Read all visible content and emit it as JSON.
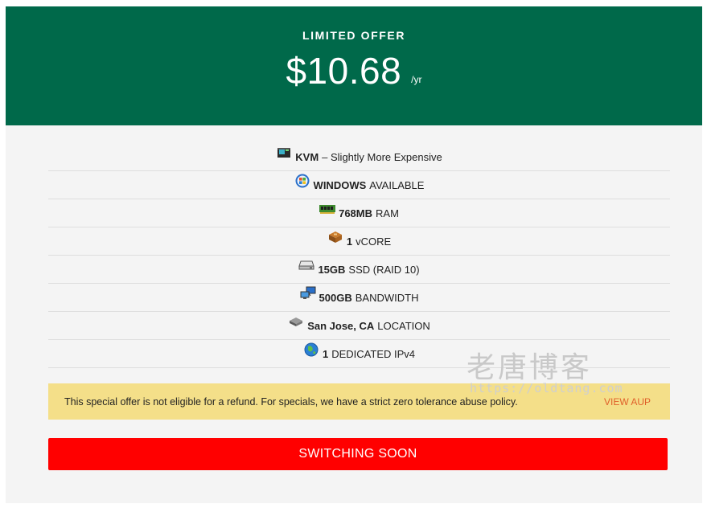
{
  "header": {
    "offer_label": "LIMITED OFFER",
    "price": "$10.68",
    "period": "/yr",
    "background": "#00694a"
  },
  "features": [
    {
      "icon": "server-box-icon",
      "bold": "KVM",
      "text": "– Slightly More Expensive"
    },
    {
      "icon": "windows-logo-icon",
      "bold": "WINDOWS",
      "text": "AVAILABLE"
    },
    {
      "icon": "ram-stick-icon",
      "bold": "768MB",
      "text": "RAM"
    },
    {
      "icon": "cpu-chip-icon",
      "bold": "1",
      "text": "vCORE"
    },
    {
      "icon": "hard-drive-icon",
      "bold": "15GB",
      "text": "SSD (RAID 10)"
    },
    {
      "icon": "network-computers-icon",
      "bold": "500GB",
      "text": "BANDWIDTH"
    },
    {
      "icon": "location-drive-icon",
      "bold": "San Jose, CA",
      "text": "LOCATION"
    },
    {
      "icon": "globe-icon",
      "bold": "1",
      "text": "DEDICATED IPv4"
    }
  ],
  "notice": {
    "text": "This special offer is not eligible for a refund. For specials, we have a strict zero tolerance abuse policy.",
    "link": "VIEW AUP",
    "background": "#f4df89"
  },
  "cta": {
    "label": "SWITCHING SOON",
    "color": "#ff0000"
  },
  "watermark": {
    "title": "老唐博客",
    "url": "https://oldtang.com"
  }
}
